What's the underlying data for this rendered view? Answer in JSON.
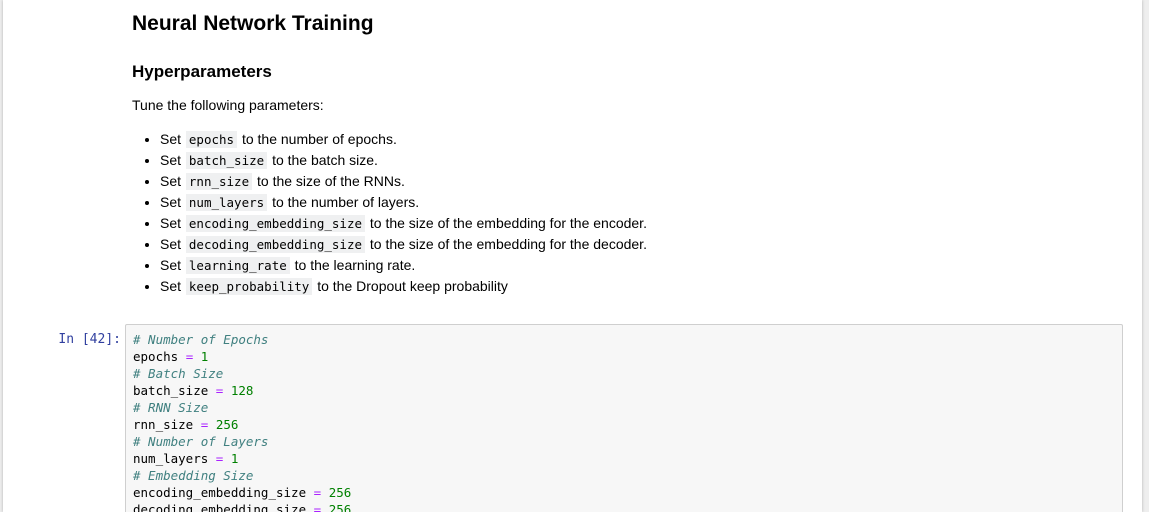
{
  "markdown": {
    "title": "Neural Network Training",
    "subtitle": "Hyperparameters",
    "intro": "Tune the following parameters:",
    "items": [
      {
        "prefix": "Set",
        "code": "epochs",
        "text": "to the number of epochs."
      },
      {
        "prefix": "Set",
        "code": "batch_size",
        "text": "to the batch size."
      },
      {
        "prefix": "Set",
        "code": "rnn_size",
        "text": "to the size of the RNNs."
      },
      {
        "prefix": "Set",
        "code": "num_layers",
        "text": "to the number of layers."
      },
      {
        "prefix": "Set",
        "code": "encoding_embedding_size",
        "text": "to the size of the embedding for the encoder."
      },
      {
        "prefix": "Set",
        "code": "decoding_embedding_size",
        "text": "to the size of the embedding for the decoder."
      },
      {
        "prefix": "Set",
        "code": "learning_rate",
        "text": "to the learning rate."
      },
      {
        "prefix": "Set",
        "code": "keep_probability",
        "text": "to the Dropout keep probability"
      }
    ]
  },
  "code_cell": {
    "prompt": "In [42]:",
    "lines": [
      {
        "kind": "comment",
        "text": "# Number of Epochs"
      },
      {
        "kind": "assign",
        "var": "epochs",
        "op": "=",
        "value": "1"
      },
      {
        "kind": "comment",
        "text": "# Batch Size"
      },
      {
        "kind": "assign",
        "var": "batch_size",
        "op": "=",
        "value": "128"
      },
      {
        "kind": "comment",
        "text": "# RNN Size"
      },
      {
        "kind": "assign",
        "var": "rnn_size",
        "op": "=",
        "value": "256"
      },
      {
        "kind": "comment",
        "text": "# Number of Layers"
      },
      {
        "kind": "assign",
        "var": "num_layers",
        "op": "=",
        "value": "1"
      },
      {
        "kind": "comment",
        "text": "# Embedding Size"
      },
      {
        "kind": "assign",
        "var": "encoding_embedding_size",
        "op": "=",
        "value": "256"
      },
      {
        "kind": "assign",
        "var": "decoding_embedding_size",
        "op": "=",
        "value": "256"
      }
    ]
  },
  "colors": {
    "comment": "#408080",
    "operator": "#aa22ff",
    "number": "#008000",
    "prompt": "#303f9f"
  }
}
